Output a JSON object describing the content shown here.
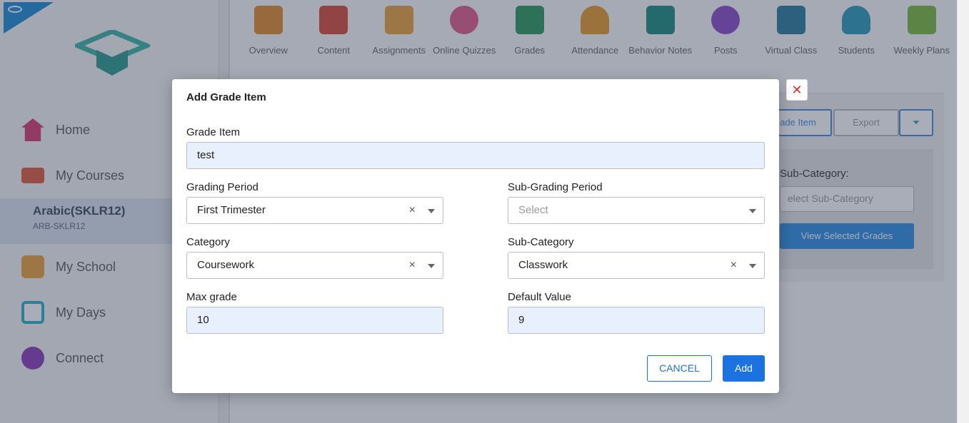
{
  "sidebar": {
    "items": [
      {
        "label": "Home",
        "icon": "home-icon",
        "color": "#d63c6e"
      },
      {
        "label": "My Courses",
        "icon": "courses-icon",
        "color": "#e05a3a"
      }
    ],
    "course": {
      "name": "Arabic(SKLR12)",
      "code": "ARB-SKLR12"
    },
    "items2": [
      {
        "label": "My School",
        "icon": "school-icon",
        "color": "#e8a23a"
      },
      {
        "label": "My Days",
        "icon": "calendar-icon",
        "color": "#2ab0c8"
      },
      {
        "label": "Connect",
        "icon": "connect-icon",
        "color": "#8a3ab8"
      }
    ]
  },
  "topnav": {
    "tabs": [
      {
        "label": "Overview",
        "color": "#e08a2a"
      },
      {
        "label": "Content",
        "color": "#d84a3a"
      },
      {
        "label": "Assignments",
        "color": "#e8a23a"
      },
      {
        "label": "Online Quizzes",
        "color": "#e05a8a"
      },
      {
        "label": "Grades",
        "color": "#2a9a5a"
      },
      {
        "label": "Attendance",
        "color": "#e89a2a"
      },
      {
        "label": "Behavior Notes",
        "color": "#1a8a7a"
      },
      {
        "label": "Posts",
        "color": "#8a4ac8"
      },
      {
        "label": "Virtual Class",
        "color": "#2a7a9a"
      },
      {
        "label": "Students",
        "color": "#2a9ab8"
      },
      {
        "label": "Weekly Plans",
        "color": "#7ab83a"
      }
    ]
  },
  "background": {
    "grade_item_btn": "ade Item",
    "export_btn": "Export",
    "subcategory_label": "Sub-Category:",
    "subcategory_placeholder": "elect Sub-Category",
    "view_selected_btn": "View Selected Grades"
  },
  "modal": {
    "title": "Add Grade Item",
    "close_symbol": "✕",
    "grade_item": {
      "label": "Grade Item",
      "value": "test"
    },
    "grading_period": {
      "label": "Grading Period",
      "value": "First Trimester"
    },
    "sub_grading_period": {
      "label": "Sub-Grading Period",
      "placeholder": "Select"
    },
    "category": {
      "label": "Category",
      "value": "Coursework"
    },
    "sub_category": {
      "label": "Sub-Category",
      "value": "Classwork"
    },
    "max_grade": {
      "label": "Max grade",
      "value": "10"
    },
    "default_value": {
      "label": "Default Value",
      "value": "9"
    },
    "cancel_label": "CANCEL",
    "add_label": "Add",
    "clear_symbol": "×"
  }
}
